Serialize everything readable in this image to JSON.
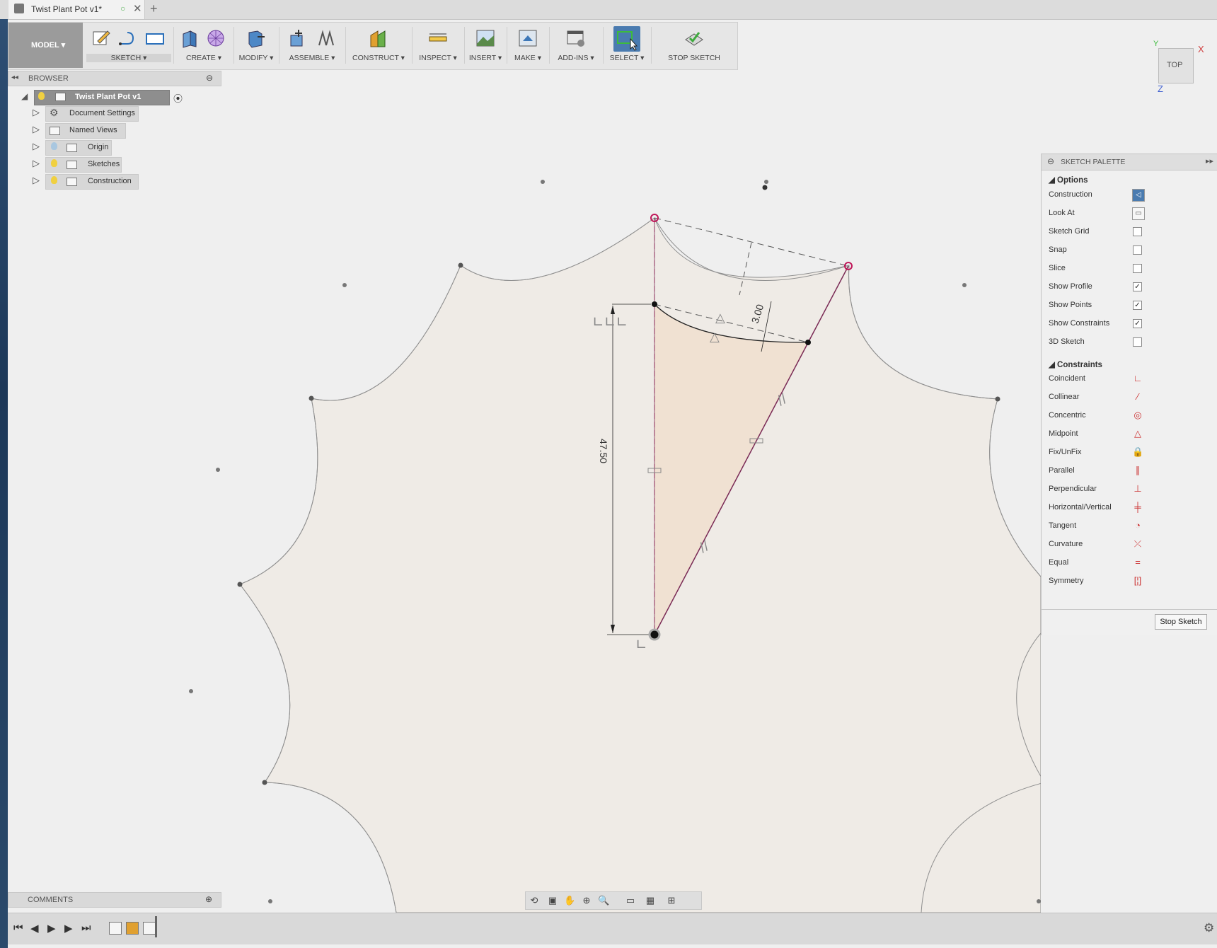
{
  "tab": {
    "title": "Twist Plant Pot v1*",
    "close_glyph": "✕",
    "new_glyph": "+"
  },
  "toolbar": {
    "model_label": "MODEL ▾",
    "groups": [
      {
        "label": "SKETCH ▾"
      },
      {
        "label": "CREATE ▾"
      },
      {
        "label": "MODIFY ▾"
      },
      {
        "label": "ASSEMBLE ▾"
      },
      {
        "label": "CONSTRUCT ▾"
      },
      {
        "label": "INSPECT ▾"
      },
      {
        "label": "INSERT ▾"
      },
      {
        "label": "MAKE ▾"
      },
      {
        "label": "ADD-INS ▾"
      },
      {
        "label": "SELECT ▾"
      },
      {
        "label": "STOP SKETCH"
      }
    ]
  },
  "browser": {
    "title": "BROWSER",
    "root": "Twist Plant Pot v1",
    "items": [
      {
        "label": "Document Settings",
        "icon": "gear-icon"
      },
      {
        "label": "Named Views",
        "icon": "folder-icon"
      },
      {
        "label": "Origin",
        "icon": "bulb-icon"
      },
      {
        "label": "Sketches",
        "icon": "bulb-icon"
      },
      {
        "label": "Construction",
        "icon": "bulb-icon"
      }
    ]
  },
  "viewcube": {
    "face": "TOP",
    "axis_x": "X",
    "axis_y": "Y",
    "axis_z": "Z"
  },
  "sketch": {
    "dimensions": {
      "vertical": "47.50",
      "offset": "3.00"
    },
    "colors": {
      "profile_fill": "#f0e1d2",
      "region_fill": "#efebe6",
      "constraint_pink": "#c0185a"
    }
  },
  "palette": {
    "title": "SKETCH PALETTE",
    "options_header": "Options",
    "options": [
      {
        "label": "Construction",
        "type": "button",
        "active": true
      },
      {
        "label": "Look At",
        "type": "button",
        "active": false
      },
      {
        "label": "Sketch Grid",
        "type": "checkbox",
        "checked": false
      },
      {
        "label": "Snap",
        "type": "checkbox",
        "checked": false
      },
      {
        "label": "Slice",
        "type": "checkbox",
        "checked": false
      },
      {
        "label": "Show Profile",
        "type": "checkbox",
        "checked": true
      },
      {
        "label": "Show Points",
        "type": "checkbox",
        "checked": true
      },
      {
        "label": "Show Constraints",
        "type": "checkbox",
        "checked": true
      },
      {
        "label": "3D Sketch",
        "type": "checkbox",
        "checked": false
      }
    ],
    "constraints_header": "Constraints",
    "constraints": [
      {
        "label": "Coincident",
        "glyph": "∟"
      },
      {
        "label": "Collinear",
        "glyph": "⁄"
      },
      {
        "label": "Concentric",
        "glyph": "◎"
      },
      {
        "label": "Midpoint",
        "glyph": "△"
      },
      {
        "label": "Fix/UnFix",
        "glyph": "🔒"
      },
      {
        "label": "Parallel",
        "glyph": "∥"
      },
      {
        "label": "Perpendicular",
        "glyph": "⊥"
      },
      {
        "label": "Horizontal/Vertical",
        "glyph": "╪"
      },
      {
        "label": "Tangent",
        "glyph": "◔"
      },
      {
        "label": "Curvature",
        "glyph": "⤫"
      },
      {
        "label": "Equal",
        "glyph": "="
      },
      {
        "label": "Symmetry",
        "glyph": "[¦]"
      }
    ],
    "stop_button": "Stop Sketch"
  },
  "comments": {
    "title": "COMMENTS"
  }
}
